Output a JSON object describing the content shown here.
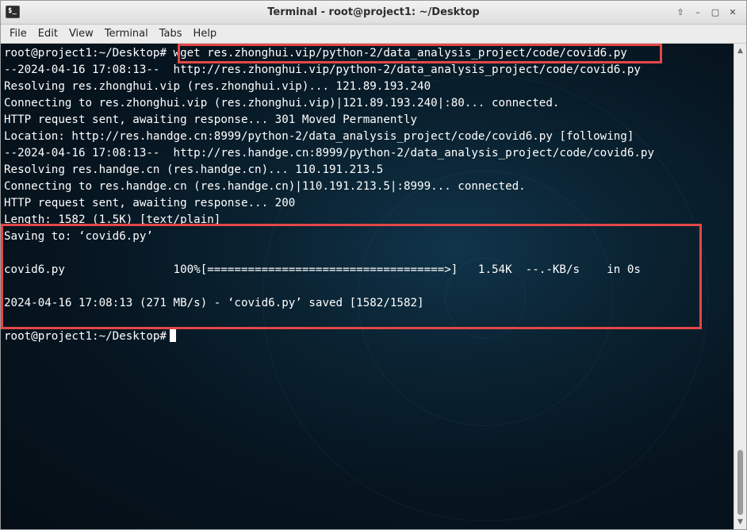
{
  "window": {
    "title": "Terminal - root@project1: ~/Desktop",
    "app_icon_glyph": "$_",
    "buttons": {
      "up": "⇧",
      "minimize": "–",
      "maximize": "▢",
      "close": "✕"
    }
  },
  "menubar": {
    "items": [
      "File",
      "Edit",
      "View",
      "Terminal",
      "Tabs",
      "Help"
    ]
  },
  "terminal": {
    "prompt": "root@project1:~/Desktop#",
    "command": "wget res.zhonghui.vip/python-2/data_analysis_project/code/covid6.py",
    "lines": [
      "--2024-04-16 17:08:13--  http://res.zhonghui.vip/python-2/data_analysis_project/code/covid6.py",
      "Resolving res.zhonghui.vip (res.zhonghui.vip)... 121.89.193.240",
      "Connecting to res.zhonghui.vip (res.zhonghui.vip)|121.89.193.240|:80... connected.",
      "HTTP request sent, awaiting response... 301 Moved Permanently",
      "Location: http://res.handge.cn:8999/python-2/data_analysis_project/code/covid6.py [following]",
      "--2024-04-16 17:08:13--  http://res.handge.cn:8999/python-2/data_analysis_project/code/covid6.py",
      "Resolving res.handge.cn (res.handge.cn)... 110.191.213.5",
      "Connecting to res.handge.cn (res.handge.cn)|110.191.213.5|:8999... connected.",
      "HTTP request sent, awaiting response... 200",
      "Length: 1582 (1.5K) [text/plain]",
      "Saving to: ‘covid6.py’",
      "",
      "covid6.py                100%[===================================>]   1.54K  --.-KB/s    in 0s",
      "",
      "2024-04-16 17:08:13 (271 MB/s) - ‘covid6.py’ saved [1582/1582]",
      ""
    ],
    "final_prompt": "root@project1:~/Desktop#"
  },
  "colors": {
    "highlight": "#e34747",
    "terminal_text": "#ffffff",
    "terminal_bg": "#071823"
  }
}
